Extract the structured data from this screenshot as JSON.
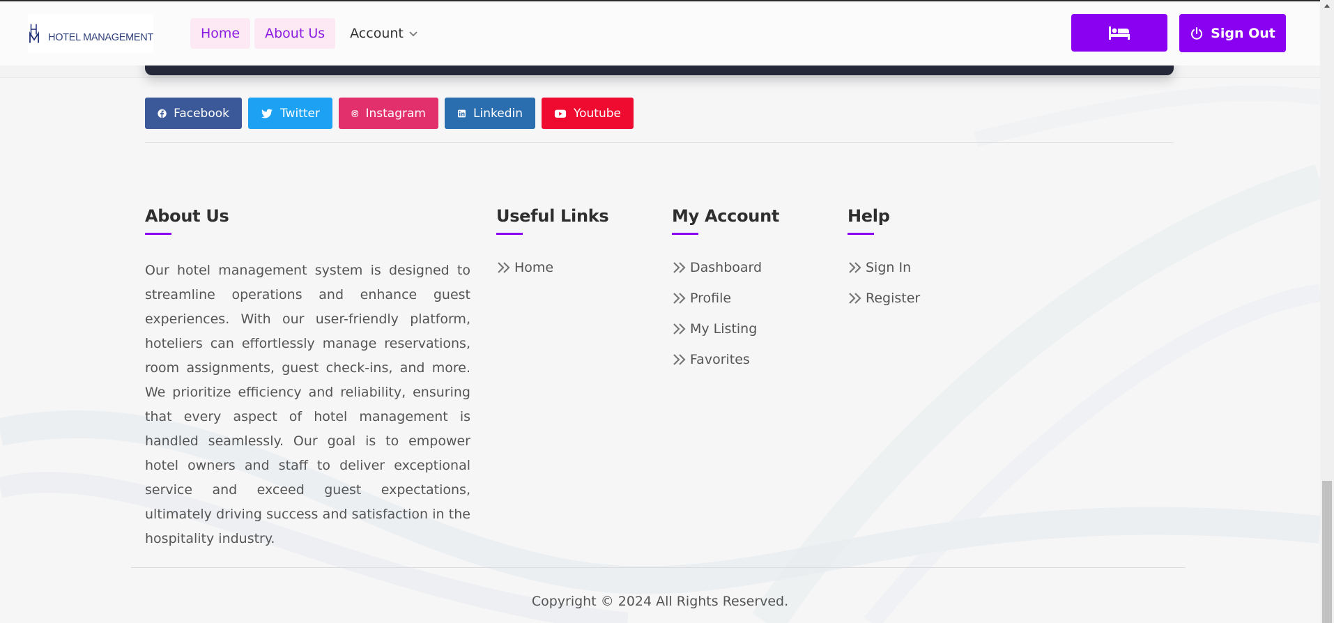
{
  "header": {
    "logo_text": "HOTEL MANAGEMENT",
    "nav": [
      {
        "label": "Home"
      },
      {
        "label": "About Us"
      },
      {
        "label": "Account"
      }
    ],
    "bed_button_icon": "bed-icon",
    "signout_label": "Sign Out"
  },
  "social": [
    {
      "label": "Facebook",
      "icon": "facebook-icon",
      "color": "#3b5998"
    },
    {
      "label": "Twitter",
      "icon": "twitter-icon",
      "color": "#1da1f2"
    },
    {
      "label": "Instagram",
      "icon": "instagram-icon",
      "color": "#e1306c"
    },
    {
      "label": "Linkedin",
      "icon": "linkedin-icon",
      "color": "#2a6eb0"
    },
    {
      "label": "Youtube",
      "icon": "youtube-icon",
      "color": "#ee0b2f"
    }
  ],
  "footer": {
    "about": {
      "title": "About Us",
      "text": "Our hotel management system is designed to streamline operations and enhance guest experiences. With our user-friendly platform, hoteliers can effortlessly manage reservations, room assignments, guest check-ins, and more. We prioritize efficiency and reliability, ensuring that every aspect of hotel management is handled seamlessly. Our goal is to empower hotel owners and staff to deliver exceptional service and exceed guest expectations, ultimately driving success and satisfaction in the hospitality industry."
    },
    "useful_links": {
      "title": "Useful Links",
      "items": [
        "Home"
      ]
    },
    "my_account": {
      "title": "My Account",
      "items": [
        "Dashboard",
        "Profile",
        "My Listing",
        "Favorites"
      ]
    },
    "help": {
      "title": "Help",
      "items": [
        "Sign In",
        "Register"
      ]
    },
    "copyright": "Copyright © 2024 All Rights Reserved."
  },
  "colors": {
    "accent": "#8a00f0",
    "nav_pill_bg": "#fce9f4"
  }
}
